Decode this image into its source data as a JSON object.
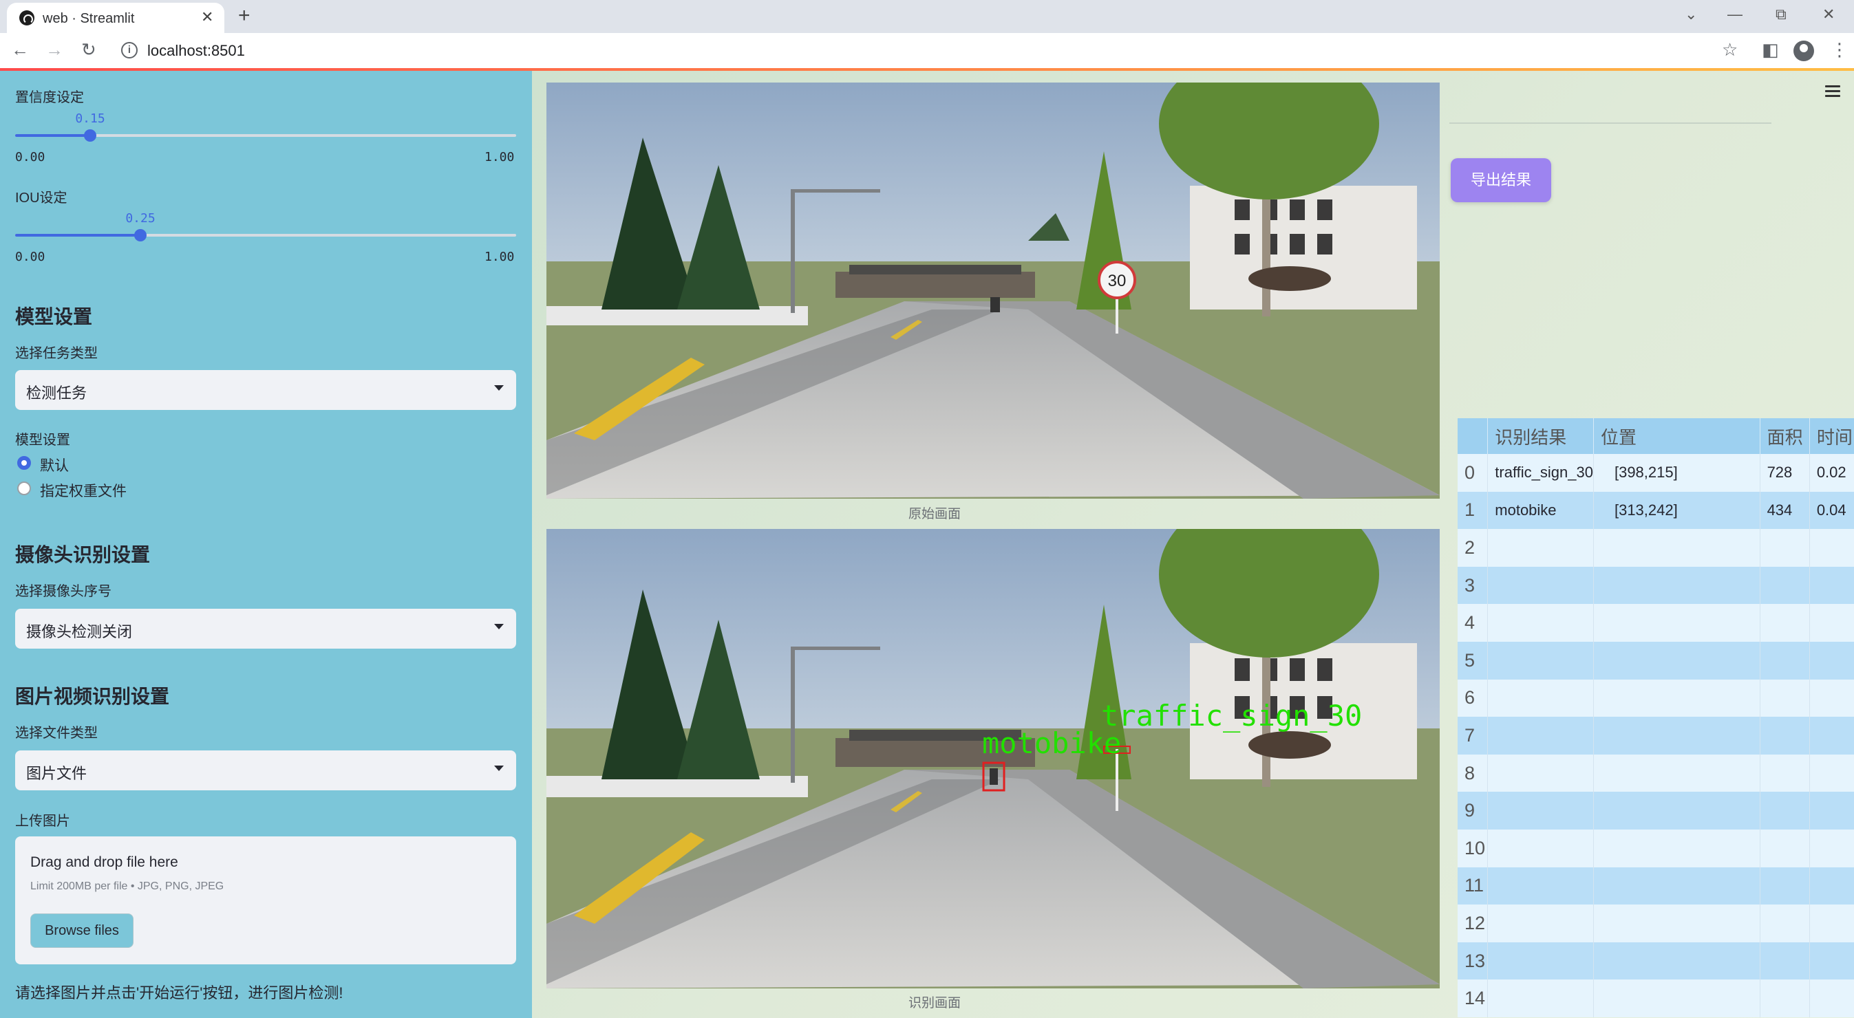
{
  "browser": {
    "tab_title": "web · Streamlit",
    "tab_close": "✕",
    "new_tab": "+",
    "url": "localhost:8501",
    "window_controls": [
      "⌄",
      "—",
      "⧉",
      "✕"
    ],
    "nav": {
      "back": "←",
      "forward": "→",
      "reload": "↻"
    },
    "toolbar_icons": [
      "star-icon",
      "sidepanel-icon",
      "profile-icon",
      "kebab-menu-icon"
    ]
  },
  "sidebar": {
    "confidence": {
      "label": "置信度设定",
      "value": 0.15,
      "value_text": "0.15",
      "min": "0.00",
      "max": "1.00"
    },
    "iou": {
      "label": "IOU设定",
      "value": 0.25,
      "value_text": "0.25",
      "min": "0.00",
      "max": "1.00"
    },
    "model_section": {
      "title": "模型设置",
      "task_label": "选择任务类型",
      "task_value": "检测任务",
      "model_label": "模型设置",
      "radio_options": [
        "默认",
        "指定权重文件"
      ],
      "radio_selected": "默认"
    },
    "camera_section": {
      "title": "摄像头识别设置",
      "select_label": "选择摄像头序号",
      "select_value": "摄像头检测关闭"
    },
    "media_section": {
      "title": "图片视频识别设置",
      "type_label": "选择文件类型",
      "type_value": "图片文件",
      "upload_label": "上传图片",
      "drop_text": "Drag and drop file here",
      "limit_text": "Limit 200MB per file • JPG, PNG, JPEG",
      "browse_label": "Browse files"
    },
    "hint": "请选择图片并点击'开始运行'按钮，进行图片检测!"
  },
  "main": {
    "original_caption": "原始画面",
    "detected_caption": "识别画面",
    "detection_labels": [
      "traffic_sign_30",
      "motobike"
    ],
    "sign_text": "30",
    "export_label": "导出结果",
    "menu_icon": "hamburger-menu-icon"
  },
  "table": {
    "columns": [
      "",
      "识别结果",
      "位置",
      "面积",
      "时间"
    ],
    "rows": [
      [
        "0",
        "traffic_sign_30",
        "[398,215]",
        "728",
        "0.02"
      ],
      [
        "1",
        "motobike",
        "[313,242]",
        "434",
        "0.04"
      ],
      [
        "2",
        "",
        "",
        "",
        ""
      ],
      [
        "3",
        "",
        "",
        "",
        ""
      ],
      [
        "4",
        "",
        "",
        "",
        ""
      ],
      [
        "5",
        "",
        "",
        "",
        ""
      ],
      [
        "6",
        "",
        "",
        "",
        ""
      ],
      [
        "7",
        "",
        "",
        "",
        ""
      ],
      [
        "8",
        "",
        "",
        "",
        ""
      ],
      [
        "9",
        "",
        "",
        "",
        ""
      ],
      [
        "10",
        "",
        "",
        "",
        ""
      ],
      [
        "11",
        "",
        "",
        "",
        ""
      ],
      [
        "12",
        "",
        "",
        "",
        ""
      ],
      [
        "13",
        "",
        "",
        "",
        ""
      ],
      [
        "14",
        "",
        "",
        "",
        ""
      ]
    ]
  },
  "colors": {
    "sidebar_bg": "#7cc6d9",
    "slider_accent": "#4169e1",
    "export_button": "#9d84f0",
    "table_header": "#9dd0f0",
    "detection_box_text": "#22e000"
  }
}
